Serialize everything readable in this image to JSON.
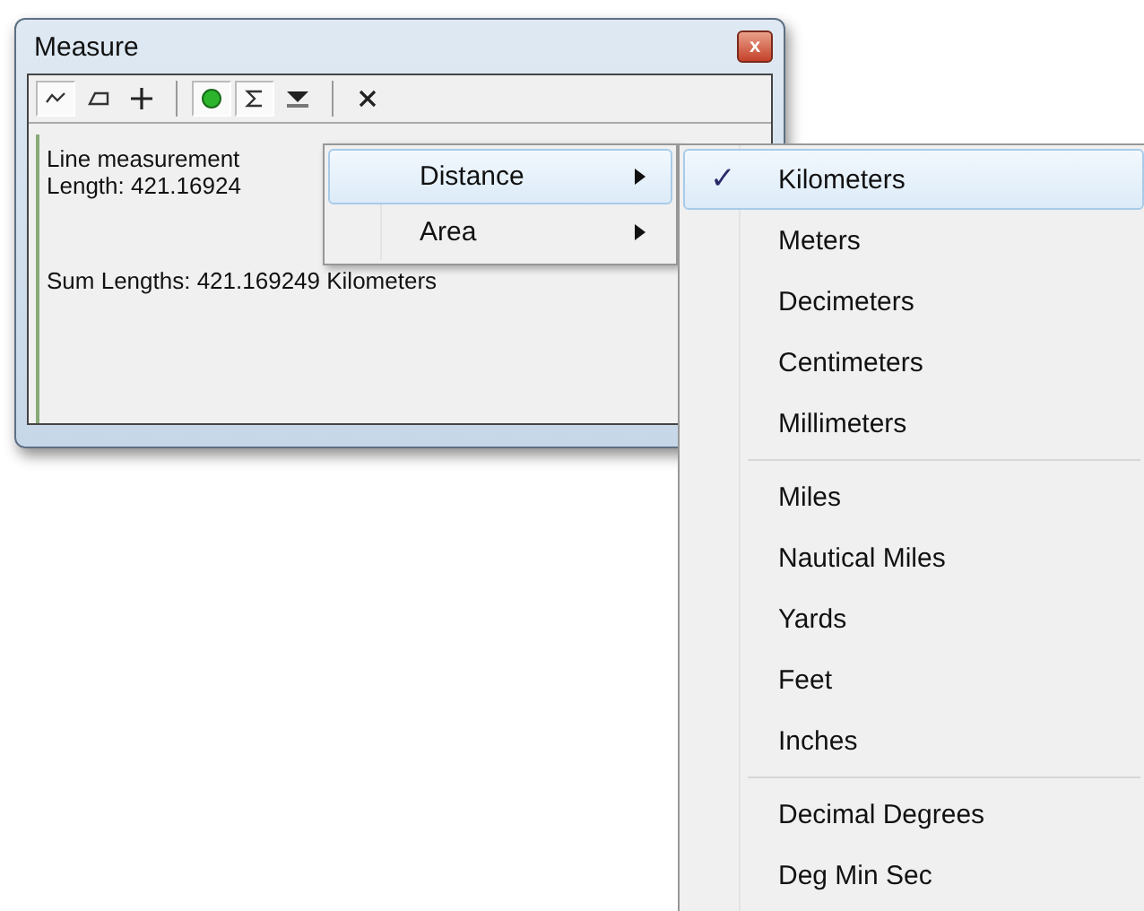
{
  "window": {
    "title": "Measure",
    "close_label": "x"
  },
  "toolbar": {
    "groups": [
      [
        {
          "kind": "line",
          "pressed": true
        },
        {
          "kind": "area",
          "pressed": false
        },
        {
          "kind": "feature",
          "pressed": false
        }
      ],
      [
        {
          "kind": "snap",
          "pressed": true
        },
        {
          "kind": "sum",
          "pressed": true
        },
        {
          "kind": "units",
          "pressed": false
        }
      ],
      [
        {
          "kind": "clear",
          "pressed": false
        }
      ]
    ]
  },
  "results": [
    "Line measurement",
    "Length: 421.16924",
    "Sum Lengths: 421.169249 Kilometers"
  ],
  "menu": {
    "items": [
      {
        "label": "Distance",
        "selected": true,
        "submenu": true
      },
      {
        "label": "Area",
        "selected": false,
        "submenu": true
      }
    ]
  },
  "submenu": {
    "check_mark": "✓",
    "groups": [
      [
        {
          "label": "Kilometers",
          "checked": true,
          "selected": true
        },
        {
          "label": "Meters",
          "checked": false,
          "selected": false
        },
        {
          "label": "Decimeters",
          "checked": false,
          "selected": false
        },
        {
          "label": "Centimeters",
          "checked": false,
          "selected": false
        },
        {
          "label": "Millimeters",
          "checked": false,
          "selected": false
        }
      ],
      [
        {
          "label": "Miles",
          "checked": false,
          "selected": false
        },
        {
          "label": "Nautical Miles",
          "checked": false,
          "selected": false
        },
        {
          "label": "Yards",
          "checked": false,
          "selected": false
        },
        {
          "label": "Feet",
          "checked": false,
          "selected": false
        },
        {
          "label": "Inches",
          "checked": false,
          "selected": false
        }
      ],
      [
        {
          "label": "Decimal Degrees",
          "checked": false,
          "selected": false
        },
        {
          "label": "Deg Min Sec",
          "checked": false,
          "selected": false
        }
      ]
    ]
  }
}
